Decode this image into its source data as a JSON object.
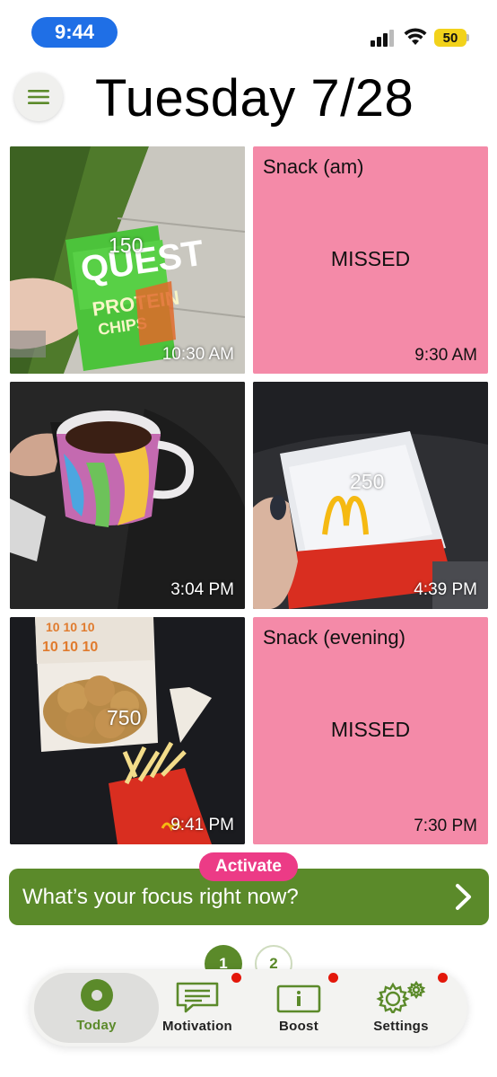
{
  "status_bar": {
    "time": "9:44",
    "battery": "50"
  },
  "header": {
    "title": "Tuesday 7/28",
    "menu_icon": "hamburger-menu-icon"
  },
  "tiles": [
    {
      "type": "photo",
      "calories": "150",
      "time": "10:30 AM"
    },
    {
      "type": "missed",
      "meal": "Snack (am)",
      "status": "MISSED",
      "time": "9:30 AM"
    },
    {
      "type": "photo",
      "calories": "",
      "time": "3:04 PM"
    },
    {
      "type": "photo",
      "calories": "250",
      "time": "4:39 PM"
    },
    {
      "type": "photo",
      "calories": "750",
      "time": "9:41 PM"
    },
    {
      "type": "missed",
      "meal": "Snack (evening)",
      "status": "MISSED",
      "time": "7:30 PM"
    }
  ],
  "focus": {
    "badge": "Activate",
    "prompt": "What’s your focus right now?",
    "chevron_icon": "chevron-right-icon"
  },
  "pager": {
    "pages": [
      "1",
      "2"
    ],
    "current": "1"
  },
  "nav": {
    "items": [
      {
        "label": "Today",
        "icon": "today-circle-icon",
        "active": true,
        "notification": false
      },
      {
        "label": "Motivation",
        "icon": "message-icon",
        "active": false,
        "notification": true
      },
      {
        "label": "Boost",
        "icon": "info-box-icon",
        "active": false,
        "notification": true
      },
      {
        "label": "Settings",
        "icon": "gear-icon",
        "active": false,
        "notification": true
      }
    ]
  },
  "colors": {
    "accent_green": "#5b8a2a",
    "missed_pink": "#f48aa8",
    "activate_pink": "#ec3b86",
    "status_blue": "#1f6fe6",
    "notification_red": "#e3170a"
  }
}
